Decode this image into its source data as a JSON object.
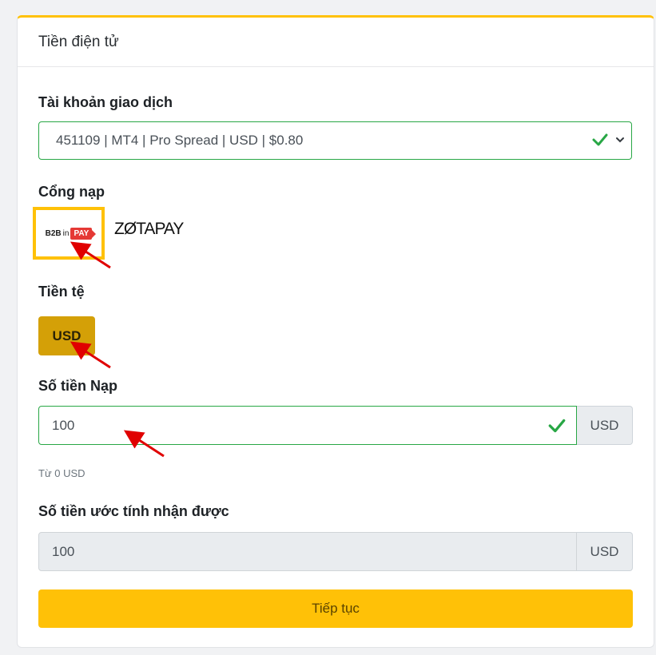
{
  "card": {
    "title": "Tiền điện tử"
  },
  "account": {
    "label": "Tài khoản giao dịch",
    "value": "451109 | MT4 | Pro Spread | USD | $0.80"
  },
  "gateway": {
    "label": "Cổng nạp",
    "b2bin": {
      "b2b": "B2B",
      "in": "in",
      "pay": "PAY"
    },
    "zotapay": "ZØTAPAY"
  },
  "currency": {
    "label": "Tiền tệ",
    "option": "USD"
  },
  "deposit": {
    "label": "Số tiền Nạp",
    "value": "100",
    "unit": "USD",
    "hint": "Từ 0 USD"
  },
  "estimate": {
    "label": "Số tiền ước tính nhận được",
    "value": "100",
    "unit": "USD"
  },
  "submit_label": "Tiếp tục",
  "colors": {
    "accent": "#ffc107",
    "valid": "#28a745",
    "annotation": "#e00000"
  }
}
